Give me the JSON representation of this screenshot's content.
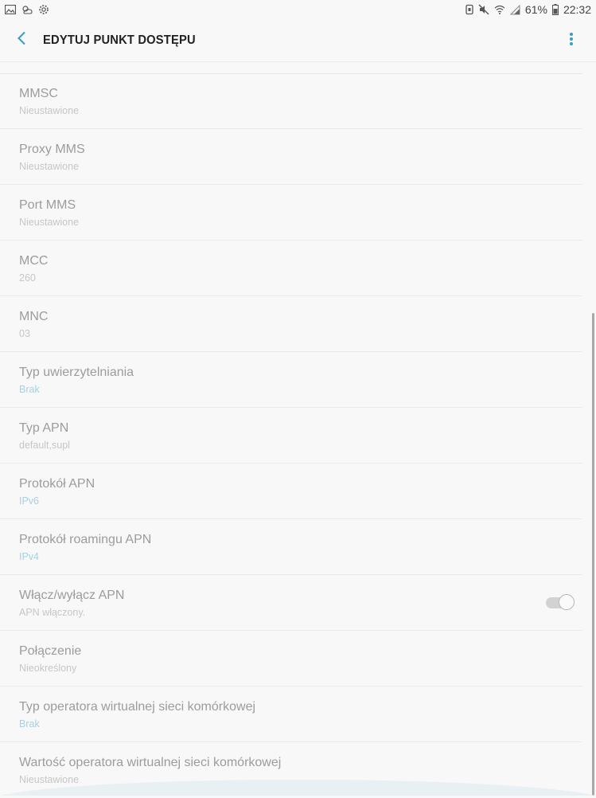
{
  "status_bar": {
    "battery_percent": "61%",
    "time": "22:32"
  },
  "toolbar": {
    "title": "EDYTUJ PUNKT DOSTĘPU"
  },
  "colors": {
    "accent": "#a9cfe2",
    "title_text": "#9c9c9c",
    "subtitle_text": "#c6c6c6"
  },
  "settings": {
    "items": [
      {
        "title": "MMSC",
        "value": "Nieustawione"
      },
      {
        "title": "Proxy MMS",
        "value": "Nieustawione"
      },
      {
        "title": "Port MMS",
        "value": "Nieustawione"
      },
      {
        "title": "MCC",
        "value": "260"
      },
      {
        "title": "MNC",
        "value": "03"
      },
      {
        "title": "Typ uwierzytelniania",
        "value": "Brak"
      },
      {
        "title": "Typ APN",
        "value": "default,supl"
      },
      {
        "title": "Protokół APN",
        "value": "IPv6"
      },
      {
        "title": "Protokół roamingu APN",
        "value": "IPv4"
      },
      {
        "title": "Włącz/wyłącz APN",
        "value": "APN włączony."
      },
      {
        "title": "Połączenie",
        "value": "Nieokreślony"
      },
      {
        "title": "Typ operatora wirtualnej sieci komórkowej",
        "value": "Brak"
      },
      {
        "title": "Wartość operatora wirtualnej sieci komórkowej",
        "value": "Nieustawione"
      }
    ],
    "apn_enabled": true
  }
}
